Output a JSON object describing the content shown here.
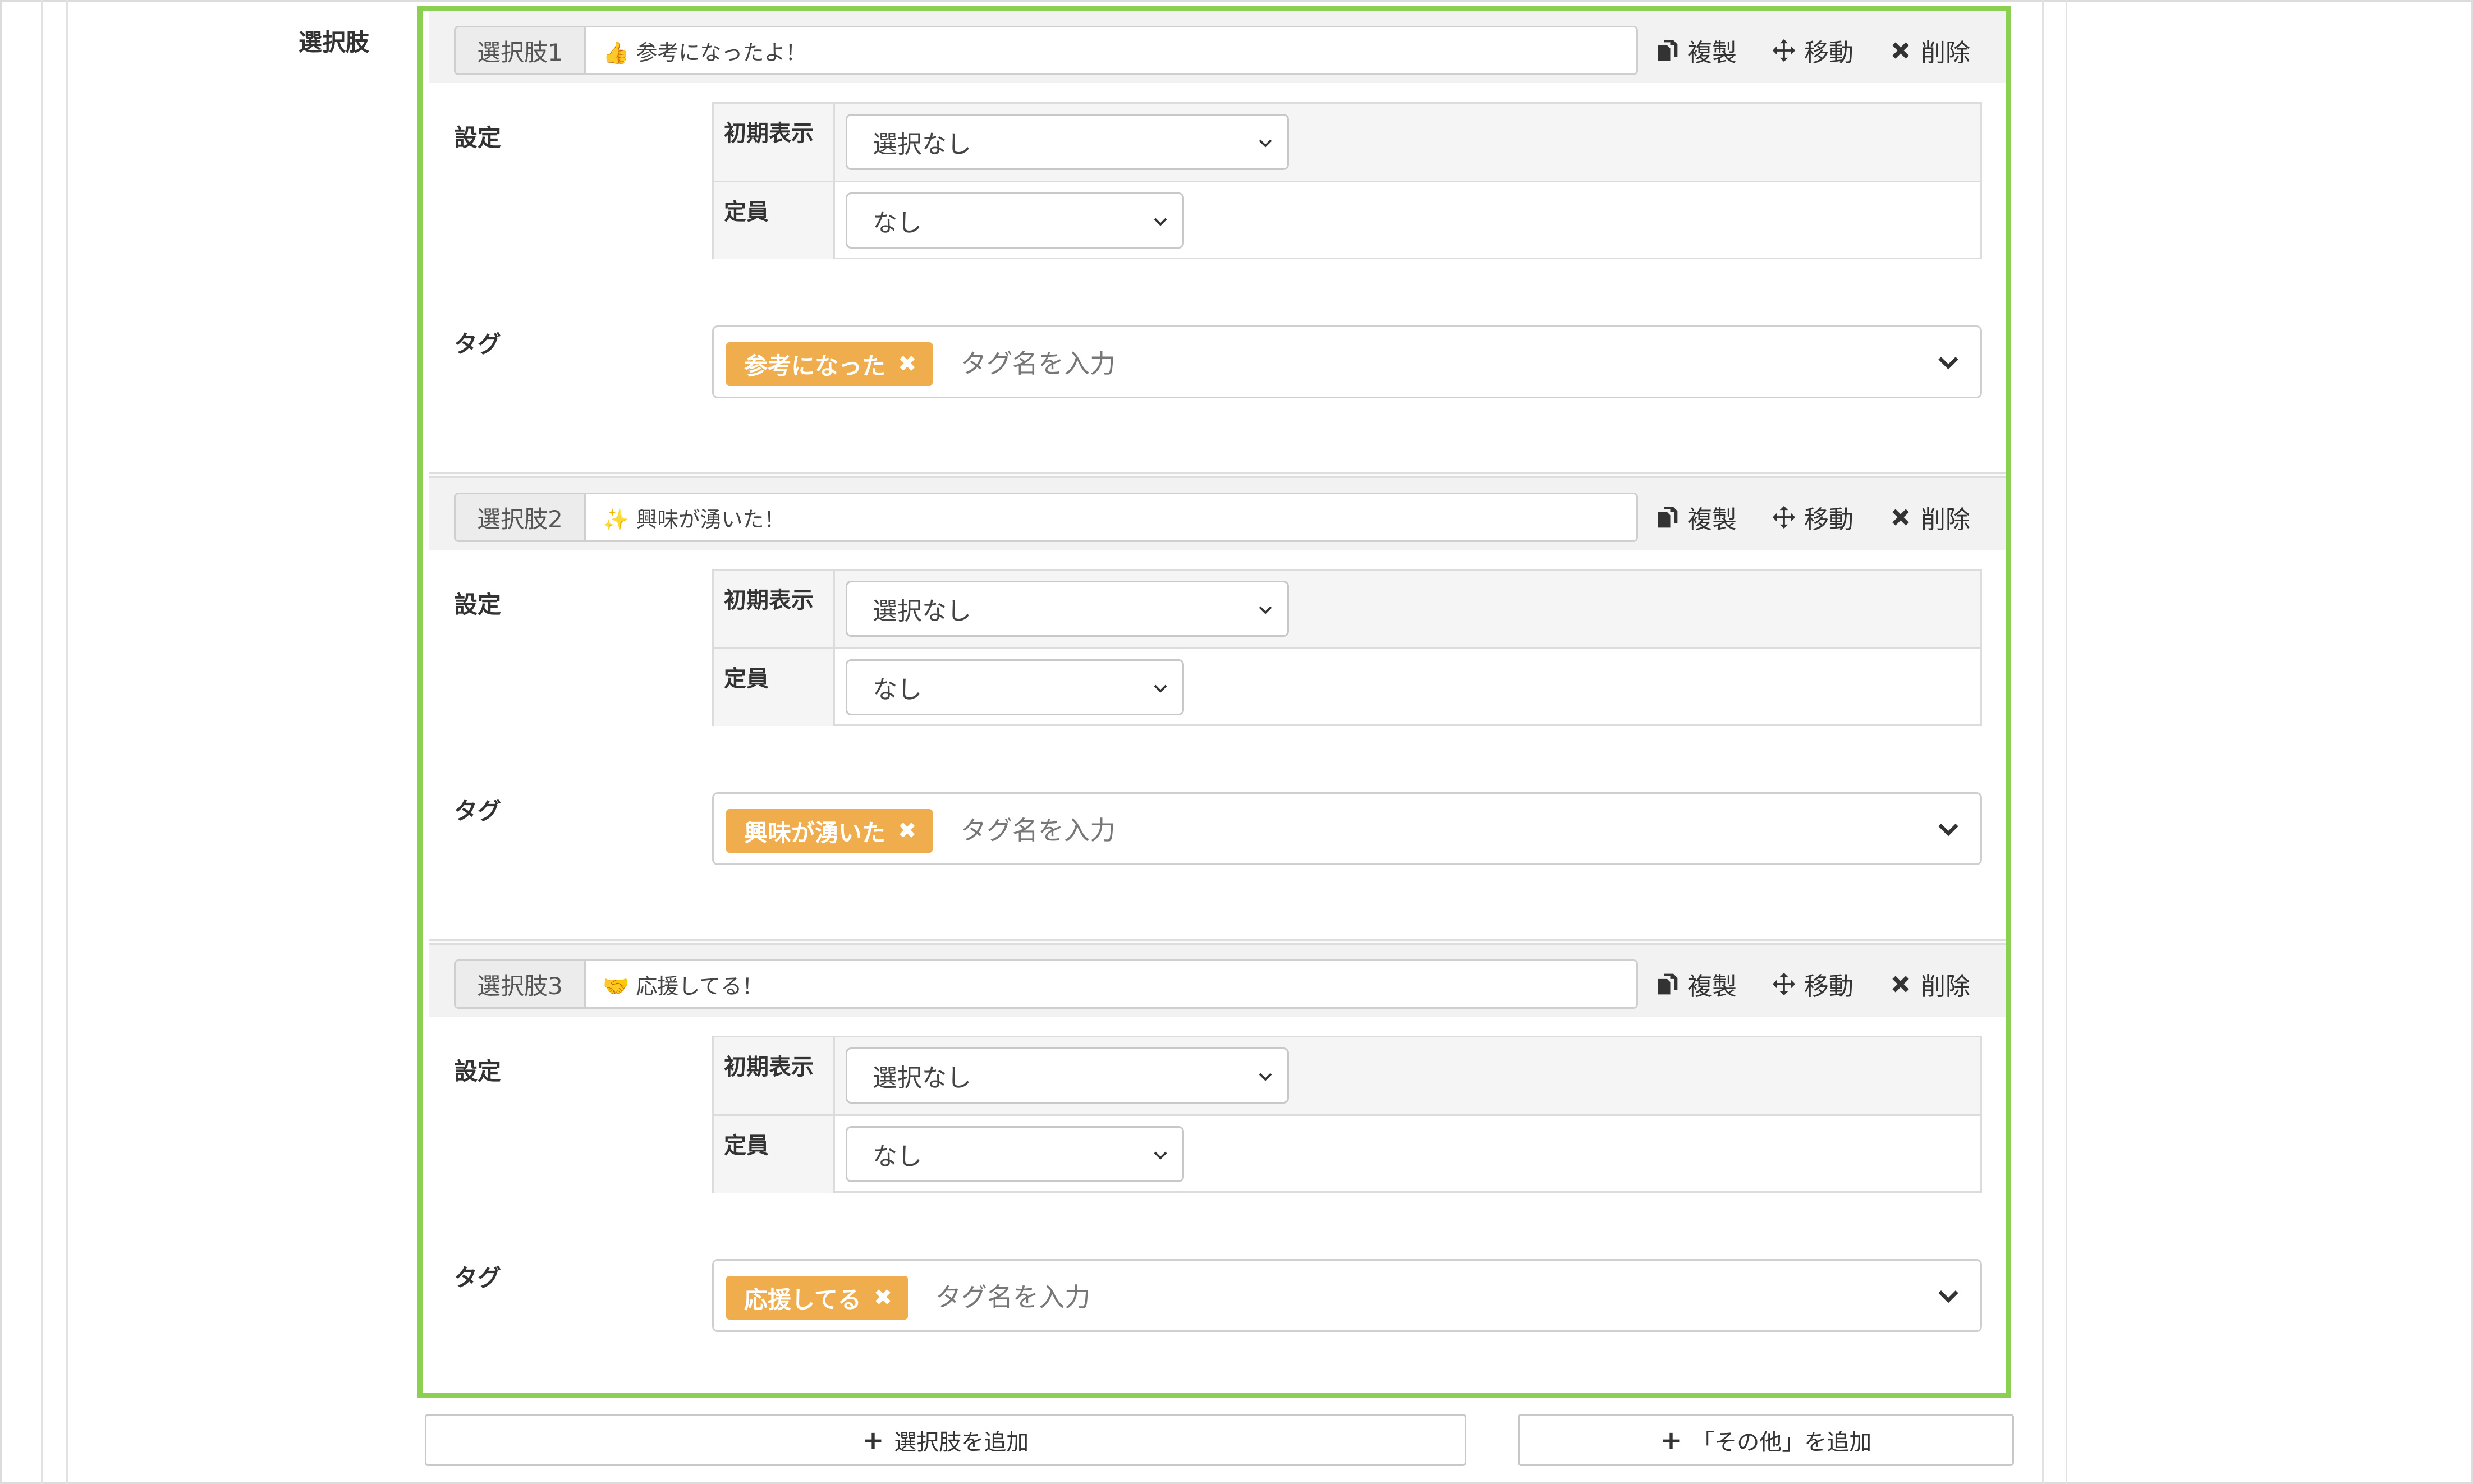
{
  "field_label": "選択肢",
  "actions": {
    "duplicate": "複製",
    "move": "移動",
    "delete": "削除"
  },
  "labels": {
    "settings": "設定",
    "initial_display": "初期表示",
    "capacity": "定員",
    "tags": "タグ"
  },
  "tag_placeholder": "タグ名を入力",
  "choices": [
    {
      "number_label": "選択肢1",
      "text": "👍 参考になったよ！",
      "initial_display": "選択なし",
      "capacity": "なし",
      "tag": "参考になった"
    },
    {
      "number_label": "選択肢2",
      "text": "✨ 興味が湧いた！",
      "initial_display": "選択なし",
      "capacity": "なし",
      "tag": "興味が湧いた"
    },
    {
      "number_label": "選択肢3",
      "text": "🤝 応援してる！",
      "initial_display": "選択なし",
      "capacity": "なし",
      "tag": "応援してる"
    }
  ],
  "tag_remove_glyph": "✖",
  "buttons": {
    "add_choice": "選択肢を追加",
    "add_other": "「その他」を追加",
    "plus_glyph": "+"
  },
  "colors": {
    "panel_border": "#8bcf53",
    "tag_bg": "#f0ad4e"
  }
}
